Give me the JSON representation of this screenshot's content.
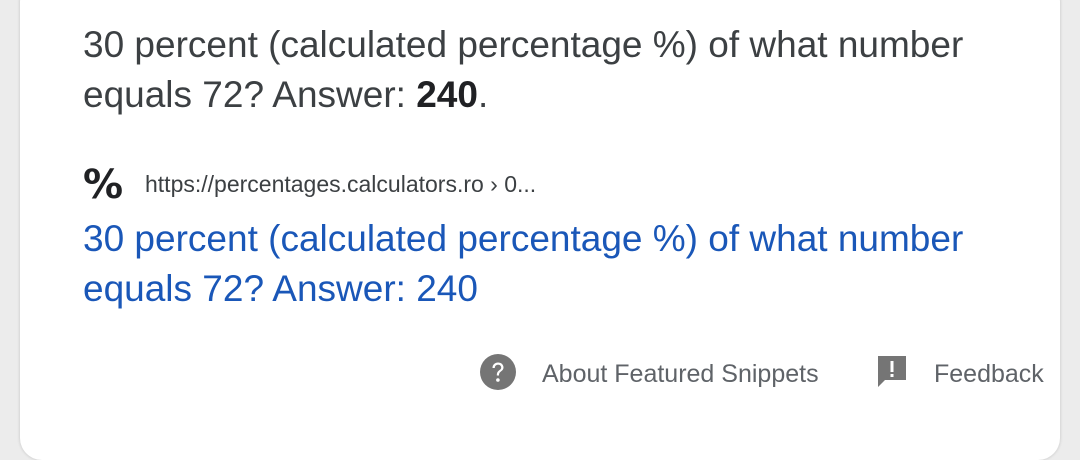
{
  "snippet": {
    "text_before": "30 percent (calculated percentage %) of what number equals 72? Answer: ",
    "answer": "240",
    "text_after": "."
  },
  "source": {
    "favicon_icon": "percent-icon",
    "favicon_glyph": "%",
    "url": "https://percentages.calculators.ro › 0..."
  },
  "result": {
    "title": "30 percent (calculated percentage %) of what number equals 72? Answer: 240"
  },
  "footer": {
    "about_icon": "help-circle-icon",
    "about_label": "About Featured Snippets",
    "feedback_icon": "feedback-icon",
    "feedback_label": "Feedback"
  },
  "colors": {
    "link": "#1a57b8",
    "text": "#3c4043",
    "muted": "#5f6368",
    "icon": "#757575"
  }
}
